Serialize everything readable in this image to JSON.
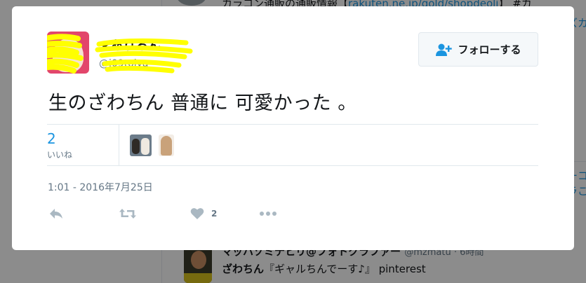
{
  "background": {
    "top_text": "カラコン通販の通販情報【",
    "top_link": "rakuten.ne.jp/gold/shopdeoli",
    "top_tail": "】 #カ",
    "right_snippets": [
      "ズカ",
      "ーコ",
      "ラこ"
    ],
    "bottom_name": "マッハゾミテヒリ@フォトクラファー",
    "bottom_handle": "@mzmatu · 6時間",
    "bottom_text_bold": "ざわちん",
    "bottom_text": "『ギャルちんでーす♪』 pinterest"
  },
  "tweet": {
    "author_name": "★ありるん",
    "author_handle": "@i09toiya",
    "follow_label": "フォローする",
    "text": "生のざわちん 普通に 可愛かった 。",
    "likes_count": "2",
    "likes_label": "いいね",
    "timestamp": "1:01 - 2016年7月25日",
    "action_like_count": "2"
  },
  "colors": {
    "accent": "#1b95e0",
    "scribble": "#ffff00",
    "avatar_bg": "#e2466b",
    "action_gray": "#aab8c2"
  },
  "icons": {
    "follow": "add-person-icon",
    "reply": "reply-icon",
    "retweet": "retweet-icon",
    "like": "heart-icon",
    "more": "more-icon"
  }
}
